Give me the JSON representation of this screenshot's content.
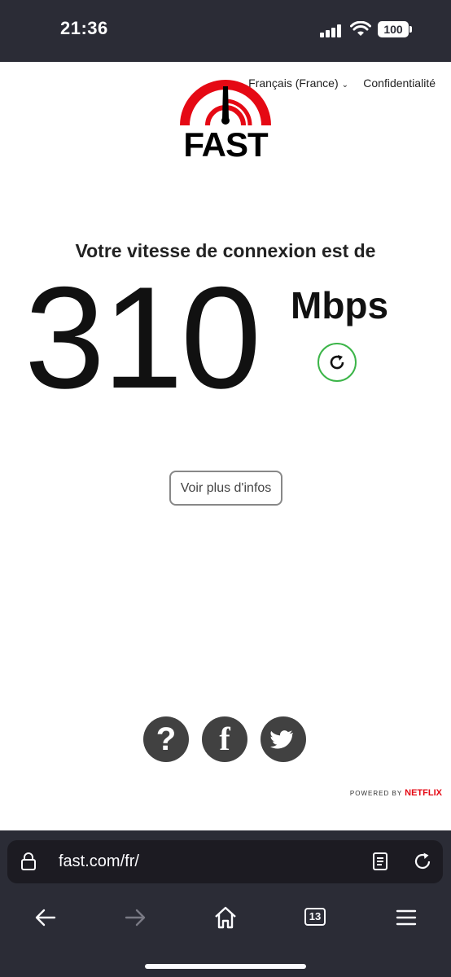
{
  "status_bar": {
    "time": "21:36",
    "battery": "100"
  },
  "header": {
    "language": "Français (France)",
    "privacy": "Confidentialité"
  },
  "logo": {
    "text": "FAST",
    "color": "#e50914"
  },
  "main": {
    "headline": "Votre vitesse de connexion est de",
    "speed_value": "310",
    "speed_unit": "Mbps",
    "more_info_label": "Voir plus d'infos"
  },
  "social": {
    "help": "?",
    "facebook": "f"
  },
  "footer": {
    "powered_by": "POWERED BY",
    "brand": "NETFLIX"
  },
  "browser": {
    "url": "fast.com/fr/",
    "tab_count": "13"
  },
  "colors": {
    "accent_green": "#3cb549",
    "brand_red": "#e50914",
    "chrome_dark": "#2b2c36"
  }
}
